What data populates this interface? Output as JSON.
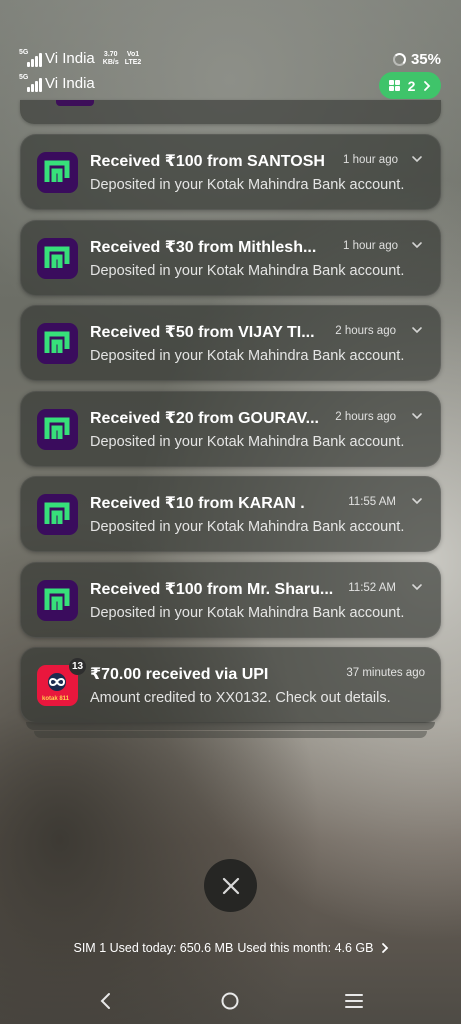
{
  "status_bar": {
    "sim1_network": "5G",
    "sim1_carrier": "Vi India",
    "net_speed_value": "3.70",
    "net_speed_unit": "KB/s",
    "volte_label": "Vo1",
    "lte_label": "LTE2",
    "sim2_network": "5G",
    "sim2_carrier": "Vi India",
    "battery": "35%",
    "battery_level": 0.35,
    "more_notifications_count": "2"
  },
  "notifications": [
    {
      "app": "payment-app",
      "title": "Received  ₹100 from SANTOSH",
      "time": "1 hour ago",
      "body": "Deposited in your Kotak Mahindra Bank account."
    },
    {
      "app": "payment-app",
      "title": "Received  ₹30 from Mithlesh...",
      "time": "1 hour ago",
      "body": "Deposited in your Kotak Mahindra Bank account."
    },
    {
      "app": "payment-app",
      "title": "Received  ₹50 from VIJAY TI...",
      "time": "2 hours ago",
      "body": "Deposited in your Kotak Mahindra Bank account."
    },
    {
      "app": "payment-app",
      "title": "Received  ₹20 from GOURAV...",
      "time": "2 hours ago",
      "body": "Deposited in your Kotak Mahindra Bank account."
    },
    {
      "app": "payment-app",
      "title": "Received  ₹10 from KARAN  .",
      "time": "11:55 AM",
      "body": "Deposited in your Kotak Mahindra Bank account."
    },
    {
      "app": "payment-app",
      "title": "Received  ₹100 from Mr. Sharu...",
      "time": "11:52 AM",
      "body": "Deposited in your Kotak Mahindra Bank account."
    }
  ],
  "upi_notification": {
    "app": "kotak-upi-app",
    "badge_count": "13",
    "title": "₹70.00 received via UPI",
    "time": "37 minutes ago",
    "body": "Amount credited to XX0132. Check out details."
  },
  "data_usage": {
    "today": "SIM 1 Used today: 650.6 MB",
    "month": "Used this month: 4.6 GB"
  },
  "colors": {
    "payment_icon_bg": "#3a0c5d",
    "payment_icon_fg": "#37e07a",
    "upi_icon_bg": "#e9173d",
    "notif_pill": "#3fc46a"
  }
}
